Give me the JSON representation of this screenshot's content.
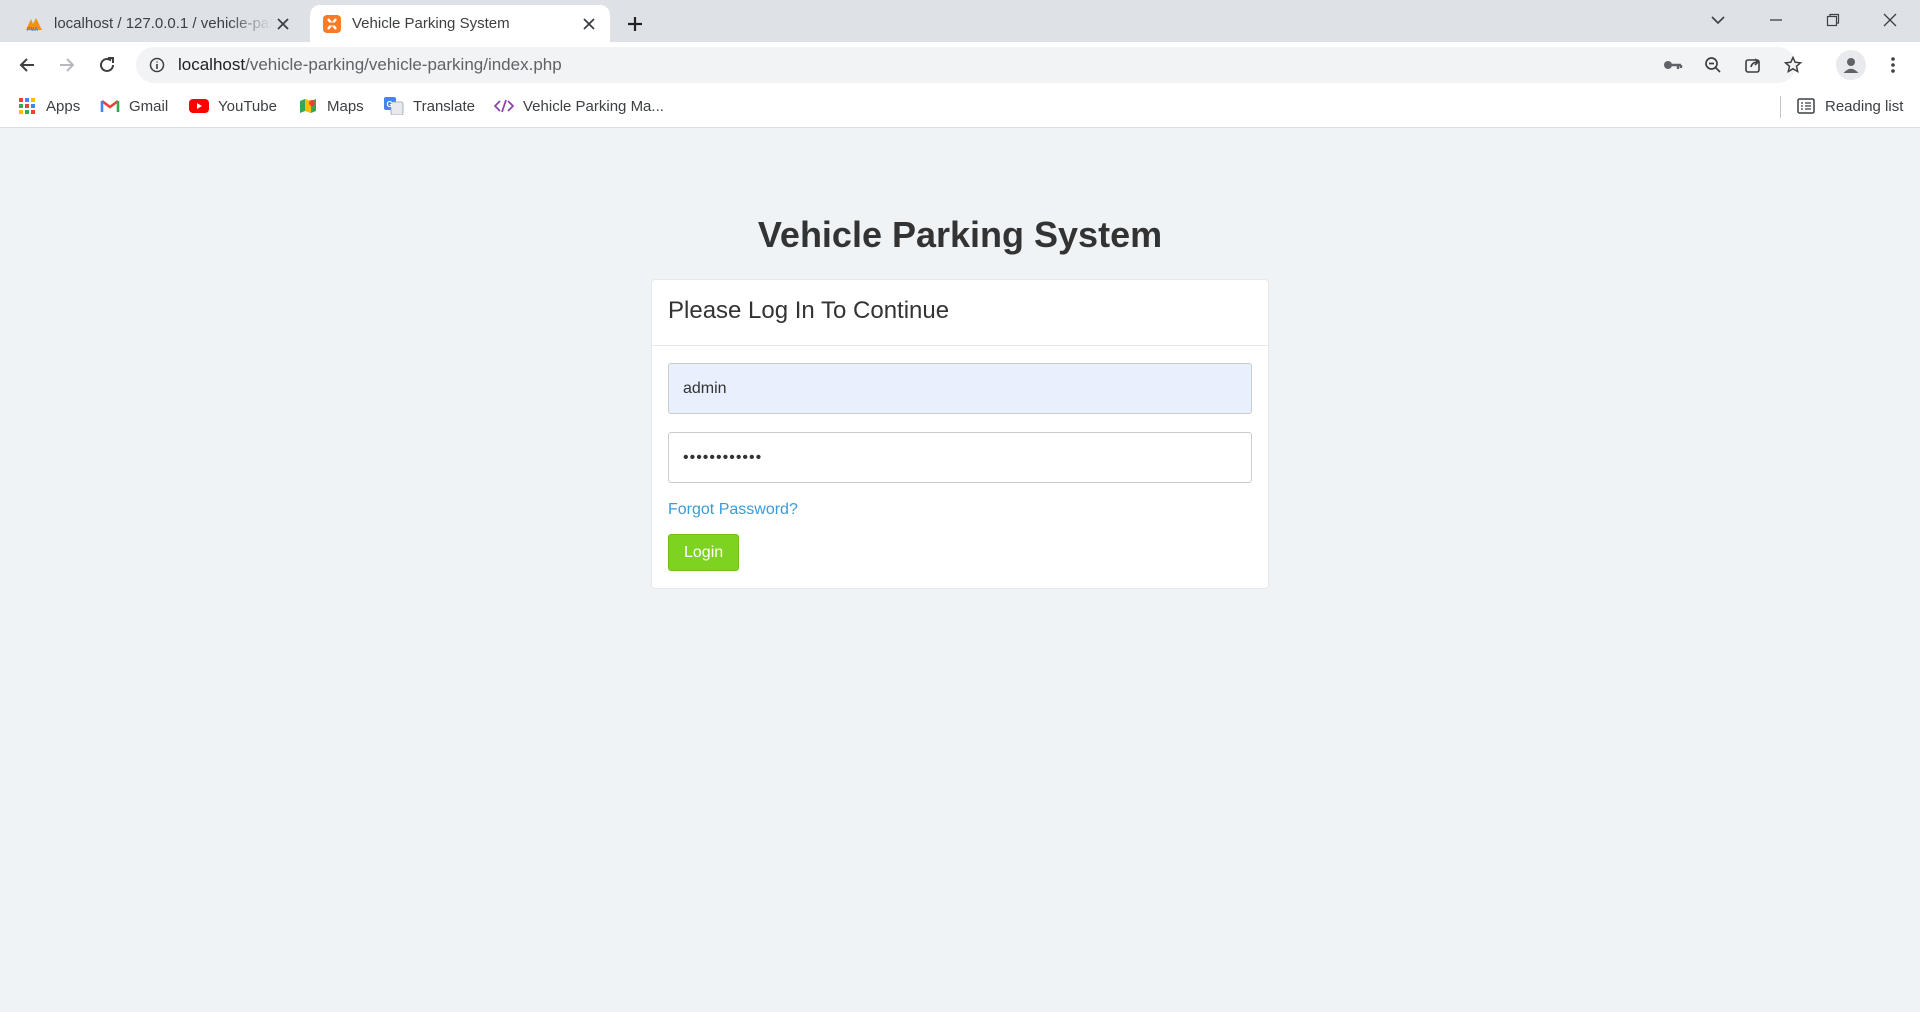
{
  "browser": {
    "tabs": [
      {
        "title": "localhost / 127.0.0.1 / vehicle-parking",
        "favicon": "phpmyadmin-icon",
        "active": false
      },
      {
        "title": "Vehicle Parking System",
        "favicon": "xampp-icon",
        "active": true
      }
    ],
    "address_bar": {
      "host": "localhost",
      "path": "/vehicle-parking/vehicle-parking/index.php"
    },
    "bookmarks": [
      {
        "label": "Apps",
        "icon": "apps-grid-icon"
      },
      {
        "label": "Gmail",
        "icon": "gmail-icon"
      },
      {
        "label": "YouTube",
        "icon": "youtube-icon"
      },
      {
        "label": "Maps",
        "icon": "maps-icon"
      },
      {
        "label": "Translate",
        "icon": "translate-icon"
      },
      {
        "label": "Vehicle Parking Ma...",
        "icon": "code-link-icon"
      }
    ],
    "reading_list": "Reading list"
  },
  "page": {
    "title": "Vehicle Parking System",
    "panel_heading": "Please Log In To Continue",
    "username_value": "admin",
    "password_value": "••••••••••••",
    "forgot_link": "Forgot Password?",
    "login_button": "Login"
  },
  "colors": {
    "page_background": "#eff3f6",
    "login_button": "#7ed321",
    "link": "#3a9bd9",
    "autofill_background": "#e8f0fe"
  }
}
